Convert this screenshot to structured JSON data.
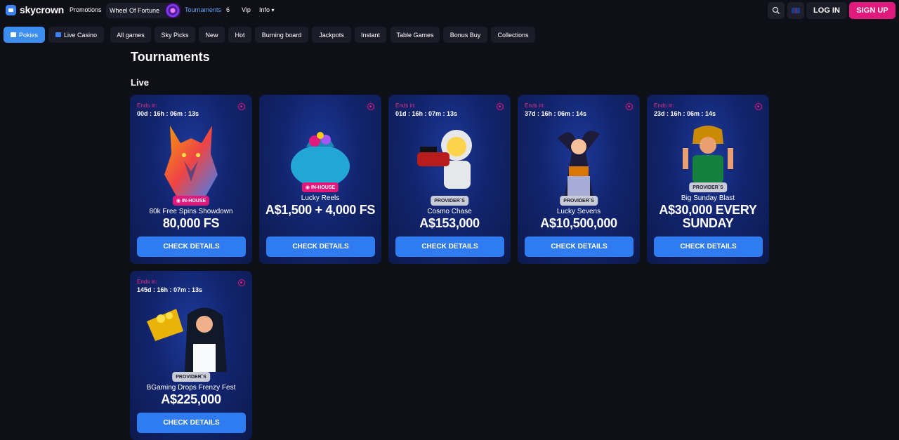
{
  "header": {
    "logo": "skycrown",
    "nav": {
      "promotions": "Promotions",
      "wheel": "Wheel Of Fortune",
      "tournaments": "Tournaments",
      "tournaments_count": "6",
      "vip": "Vip",
      "info": "Info"
    },
    "login": "LOG IN",
    "signup": "SIGN UP"
  },
  "categories": {
    "pokies": "Pokies",
    "live_casino": "Live Casino",
    "items": [
      "All games",
      "Sky Picks",
      "New",
      "Hot",
      "Burning board",
      "Jackpots",
      "Instant",
      "Table Games",
      "Bonus Buy",
      "Collections"
    ]
  },
  "page": {
    "title": "Tournaments",
    "section": "Live"
  },
  "tournaments": [
    {
      "ends_label": "Ends in:",
      "timer": "00d : 16h : 06m : 13s",
      "badge": "IN-HOUSE",
      "name": "80k Free Spins Showdown",
      "prize": "80,000 FS",
      "button": "CHECK DETAILS"
    },
    {
      "ends_label": "",
      "timer": "",
      "badge": "IN-HOUSE",
      "name": "Lucky Reels",
      "prize": "A$1,500 + 4,000 FS",
      "button": "CHECK DETAILS"
    },
    {
      "ends_label": "Ends in:",
      "timer": "01d : 16h : 07m : 13s",
      "badge": "PROVIDER`S",
      "name": "Cosmo Chase",
      "prize": "A$153,000",
      "button": "CHECK DETAILS"
    },
    {
      "ends_label": "Ends in:",
      "timer": "37d : 16h : 06m : 14s",
      "badge": "PROVIDER`S",
      "name": "Lucky Sevens",
      "prize": "A$10,500,000",
      "button": "CHECK DETAILS"
    },
    {
      "ends_label": "Ends in:",
      "timer": "23d : 16h : 06m : 14s",
      "badge": "PROVIDER`S",
      "name": "Big Sunday Blast",
      "prize": "A$30,000 EVERY SUNDAY",
      "button": "CHECK DETAILS"
    },
    {
      "ends_label": "Ends in:",
      "timer": "145d : 16h : 07m : 13s",
      "badge": "PROVIDER`S",
      "name": "BGaming Drops Frenzy Fest",
      "prize": "A$225,000",
      "button": "CHECK DETAILS"
    }
  ]
}
